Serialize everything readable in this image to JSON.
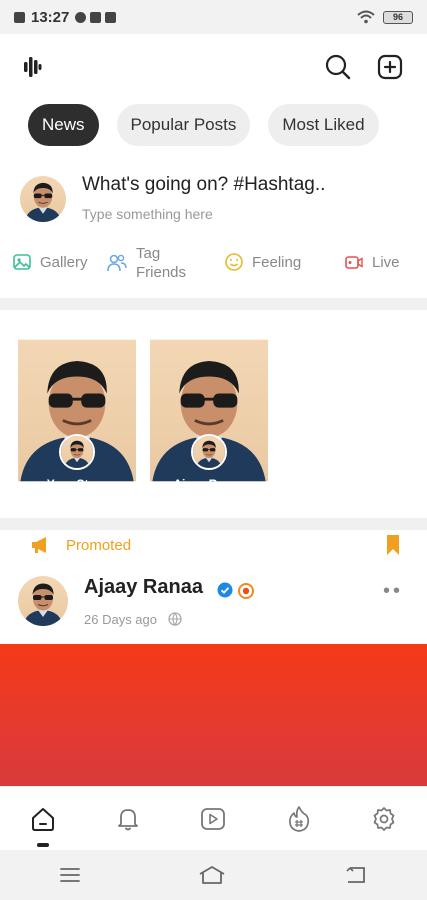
{
  "status_bar": {
    "time": "13:27",
    "battery": "96"
  },
  "header": {
    "logo_icon": "waveform-logo-icon",
    "search_icon": "search-icon",
    "create_icon": "add-square-icon"
  },
  "tabs": [
    {
      "label": "News",
      "active": true
    },
    {
      "label": "Popular Posts",
      "active": false
    },
    {
      "label": "Most Liked",
      "active": false
    }
  ],
  "composer": {
    "prompt": "What's going on? #Hashtag..",
    "placeholder": "Type something here",
    "actions": [
      {
        "label": "Gallery",
        "icon": "image-icon",
        "color": "#3bbf9a"
      },
      {
        "label": "Tag\nFriends",
        "icon": "users-icon",
        "color": "#6aa7e8"
      },
      {
        "label": "Feeling",
        "icon": "smile-icon",
        "color": "#e7b92c"
      },
      {
        "label": "Live",
        "icon": "video-icon",
        "color": "#e05252"
      }
    ]
  },
  "stories": [
    {
      "label": "Your Story"
    },
    {
      "label": "Ajaay Ranaa"
    }
  ],
  "post": {
    "promoted_label": "Promoted",
    "author": "Ajaay Ranaa",
    "time": "26 Days ago",
    "more": "••",
    "media_color": "#f0381c"
  },
  "bottom_nav": [
    {
      "icon": "home-icon",
      "active": true
    },
    {
      "icon": "bell-icon",
      "active": false
    },
    {
      "icon": "play-icon",
      "active": false
    },
    {
      "icon": "trending-hashtag-icon",
      "active": false
    },
    {
      "icon": "gear-icon",
      "active": false
    }
  ],
  "colors": {
    "accent": "#f0a020",
    "active_chip": "#2e2e2e",
    "verified": "#1e88e5"
  }
}
